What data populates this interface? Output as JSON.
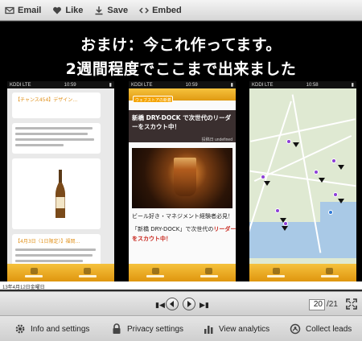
{
  "toolbar": {
    "email_label": "Email",
    "like_label": "Like",
    "save_label": "Save",
    "embed_label": "Embed"
  },
  "slide": {
    "title_line1": "おまけ：今これ作ってます。",
    "title_line2": "2週間程度でここまで出来ました",
    "phone_status": {
      "carrier": "KDDI LTE",
      "time1": "10:59",
      "time2": "10:59",
      "time3": "10:58"
    },
    "phone1": {
      "header_text": "【チャンス454】デザイン…",
      "item2_text": "【4月3日〈1日限定〉】福岡…"
    },
    "phone2": {
      "crumb_text": "ウェブストアの新着",
      "headline_text": "新橋 DRY-DOCK で次世代のリーダーをスカウト中！",
      "byline": "投稿日 undefined",
      "body_line1": "ビール好き・マネジメント経験者必見！",
      "body_line2_prefix": "「新橋 DRY-DOCK」で次世代の",
      "body_line2_red": "リーダー",
      "body_line3_red": "をスカウト中！"
    }
  },
  "caption": "13年4月12日金曜日",
  "nav": {
    "current_page": "20",
    "total_pages": "/21"
  },
  "actions": {
    "info_label": "Info and settings",
    "privacy_label": "Privacy settings",
    "analytics_label": "View analytics",
    "leads_label": "Collect leads"
  },
  "colors": {
    "accent_orange": "#f0ad1e",
    "map_pin_purple": "#8c3fd6"
  }
}
